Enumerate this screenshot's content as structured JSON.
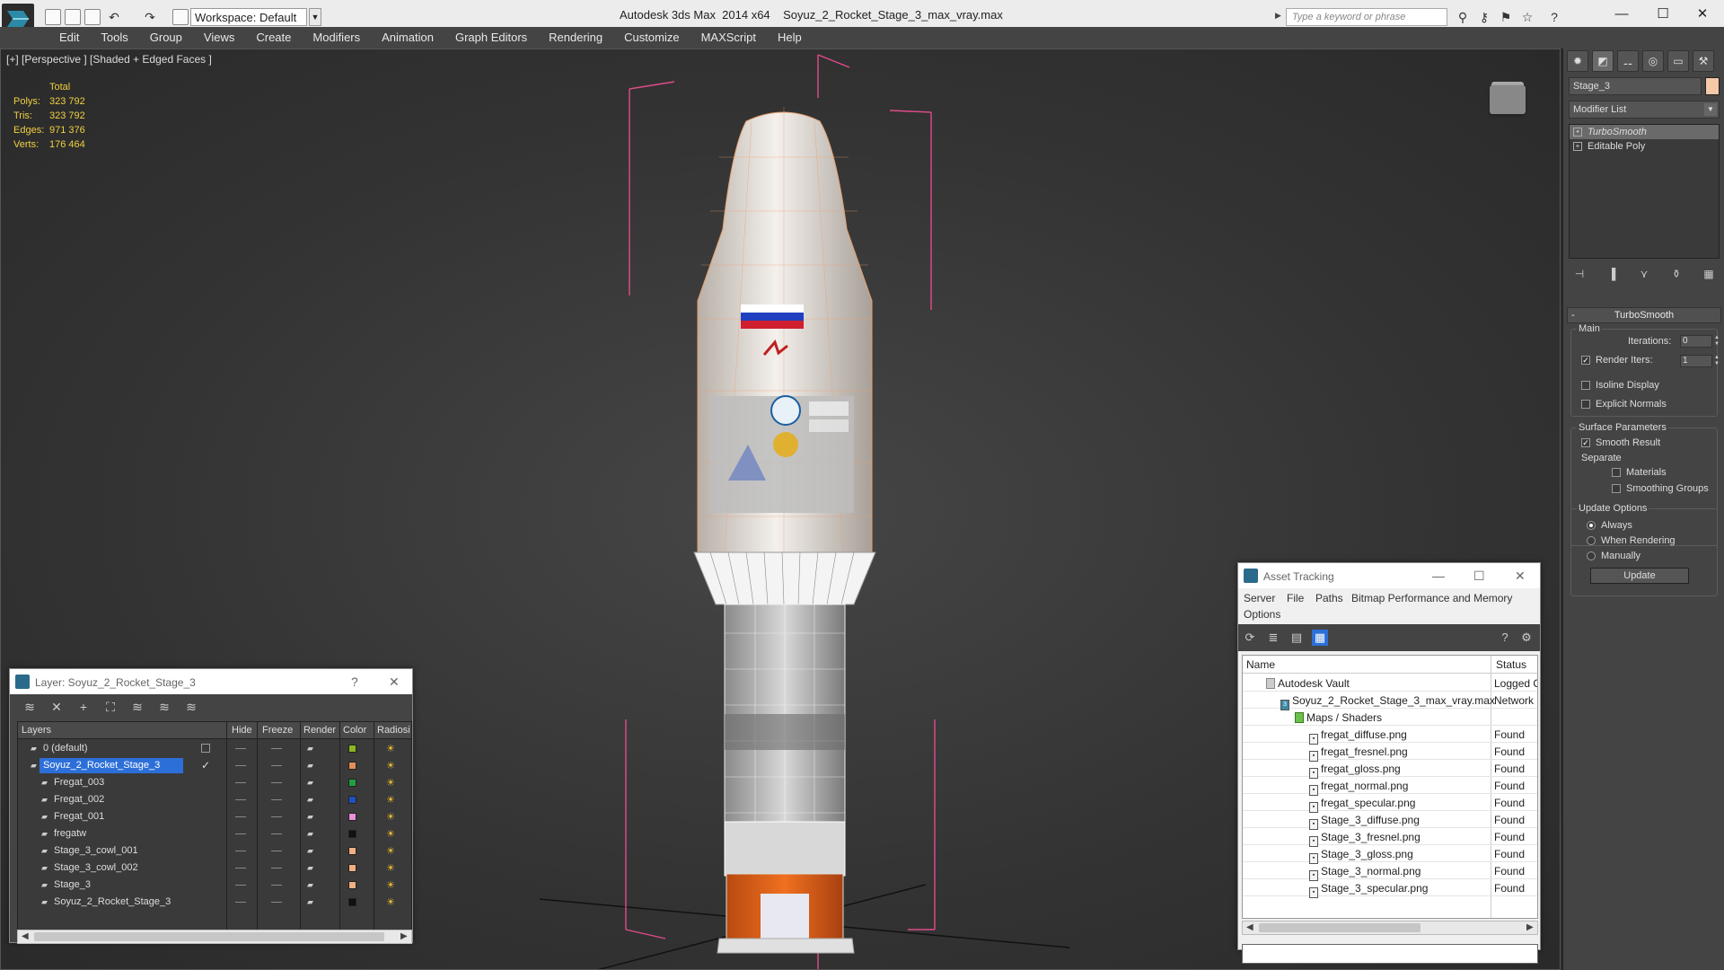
{
  "titlebar": {
    "workspace": "Workspace: Default",
    "app_title": "Autodesk 3ds Max  2014 x64",
    "file_title": "Soyuz_2_Rocket_Stage_3_max_vray.max",
    "search_placeholder": "Type a keyword or phrase",
    "minimize": "—",
    "maximize": "☐",
    "close": "✕"
  },
  "menu": [
    "Edit",
    "Tools",
    "Group",
    "Views",
    "Create",
    "Modifiers",
    "Animation",
    "Graph Editors",
    "Rendering",
    "Customize",
    "MAXScript",
    "Help"
  ],
  "viewport": {
    "label": "[+] [Perspective ] [Shaded + Edged Faces ]",
    "stats_header": "Total",
    "stats": [
      {
        "k": "Polys:",
        "v": "323 792"
      },
      {
        "k": "Tris:",
        "v": "323 792"
      },
      {
        "k": "Edges:",
        "v": "971 376"
      },
      {
        "k": "Verts:",
        "v": "176 464"
      }
    ]
  },
  "command_panel": {
    "object_name": "Stage_3",
    "object_color": "#f5c8a8",
    "modifier_list": "Modifier List",
    "stack": [
      "TurboSmooth",
      "Editable Poly"
    ],
    "rollout": "TurboSmooth",
    "main_group": "Main",
    "iterations_label": "Iterations:",
    "iterations": "0",
    "render_iters_label": "Render Iters:",
    "render_iters": "1",
    "isoline": "Isoline Display",
    "explicit_normals": "Explicit Normals",
    "surface_group": "Surface Parameters",
    "smooth_result": "Smooth Result",
    "separate": "Separate",
    "materials": "Materials",
    "smoothing_groups": "Smoothing Groups",
    "update_group": "Update Options",
    "always": "Always",
    "when_rendering": "When Rendering",
    "manually": "Manually",
    "update": "Update"
  },
  "layer_dialog": {
    "title": "Layer: Soyuz_2_Rocket_Stage_3",
    "help": "?",
    "close": "✕",
    "columns": [
      "Layers",
      "Hide",
      "Freeze",
      "Render",
      "Color",
      "Radiosi"
    ],
    "rows": [
      {
        "name": "0 (default)",
        "color": "#8ab820",
        "indent": 1
      },
      {
        "name": "Soyuz_2_Rocket_Stage_3",
        "color": "#e0905a",
        "indent": 1
      },
      {
        "name": "Fregat_003",
        "color": "#20a040",
        "indent": 2
      },
      {
        "name": "Fregat_002",
        "color": "#2050c0",
        "indent": 2
      },
      {
        "name": "Fregat_001",
        "color": "#e890d8",
        "indent": 2
      },
      {
        "name": "fregatw",
        "color": "#111111",
        "indent": 2
      },
      {
        "name": "Stage_3_cowl_001",
        "color": "#f0b080",
        "indent": 2
      },
      {
        "name": "Stage_3_cowl_002",
        "color": "#f0b080",
        "indent": 2
      },
      {
        "name": "Stage_3",
        "color": "#f0b080",
        "indent": 2
      },
      {
        "name": "Soyuz_2_Rocket_Stage_3",
        "color": "#111111",
        "indent": 2
      }
    ]
  },
  "asset_dialog": {
    "title": "Asset Tracking",
    "minimize": "—",
    "maximize": "☐",
    "close": "✕",
    "menu": [
      "Server",
      "File",
      "Paths",
      "Bitmap Performance and Memory",
      "Options"
    ],
    "columns": [
      "Name",
      "Status"
    ],
    "rows": [
      {
        "name": "Autodesk Vault",
        "status": "Logged Out",
        "indent": 1
      },
      {
        "name": "Soyuz_2_Rocket_Stage_3_max_vray.max",
        "status": "Network",
        "indent": 2
      },
      {
        "name": "Maps / Shaders",
        "status": "",
        "indent": 3
      },
      {
        "name": "fregat_diffuse.png",
        "status": "Found",
        "indent": 4
      },
      {
        "name": "fregat_fresnel.png",
        "status": "Found",
        "indent": 4
      },
      {
        "name": "fregat_gloss.png",
        "status": "Found",
        "indent": 4
      },
      {
        "name": "fregat_normal.png",
        "status": "Found",
        "indent": 4
      },
      {
        "name": "fregat_specular.png",
        "status": "Found",
        "indent": 4
      },
      {
        "name": "Stage_3_diffuse.png",
        "status": "Found",
        "indent": 4
      },
      {
        "name": "Stage_3_fresnel.png",
        "status": "Found",
        "indent": 4
      },
      {
        "name": "Stage_3_gloss.png",
        "status": "Found",
        "indent": 4
      },
      {
        "name": "Stage_3_normal.png",
        "status": "Found",
        "indent": 4
      },
      {
        "name": "Stage_3_specular.png",
        "status": "Found",
        "indent": 4
      }
    ]
  }
}
